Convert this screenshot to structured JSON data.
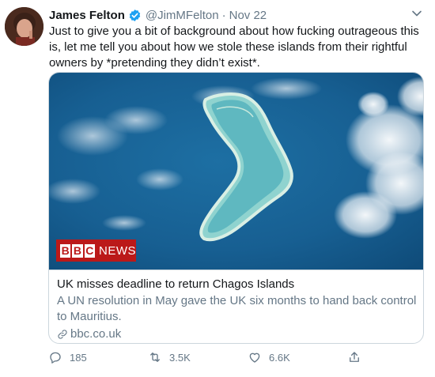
{
  "tweet": {
    "author_name": "James Felton",
    "handle": "@JimMFelton",
    "separator": "·",
    "date": "Nov 22",
    "text": "Just to give you a bit of background about how fucking outrageous this is, let me tell you about how we stole these islands from their rightful owners by *pretending they didn’t exist*."
  },
  "card": {
    "brand_letters": [
      "B",
      "B",
      "C"
    ],
    "brand_suffix": "NEWS",
    "title": "UK misses deadline to return Chagos Islands",
    "description": "A UN resolution in May gave the UK six months to hand back control to Mauritius.",
    "domain": "bbc.co.uk"
  },
  "actions": {
    "replies": "185",
    "retweets": "3.5K",
    "likes": "6.6K"
  },
  "colors": {
    "text": "#14171a",
    "secondary": "#657786",
    "verified": "#1da1f2",
    "bbc_red": "#bb1919",
    "border": "#ccd6dd"
  },
  "icons": [
    "verified-badge-icon",
    "chevron-down-icon",
    "link-icon",
    "reply-icon",
    "retweet-icon",
    "like-icon",
    "share-icon"
  ]
}
